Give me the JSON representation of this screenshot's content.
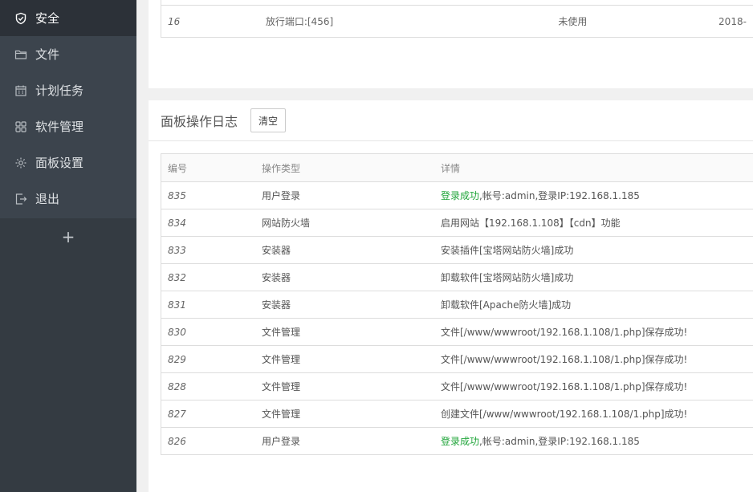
{
  "sidebar": {
    "items": [
      {
        "label": "安全",
        "icon": "shield-icon",
        "active": true
      },
      {
        "label": "文件",
        "icon": "folder-icon",
        "active": false
      },
      {
        "label": "计划任务",
        "icon": "calendar-icon",
        "active": false
      },
      {
        "label": "软件管理",
        "icon": "grid-icon",
        "active": false
      },
      {
        "label": "面板设置",
        "icon": "gear-icon",
        "active": false
      },
      {
        "label": "退出",
        "icon": "logout-icon",
        "active": false
      }
    ],
    "add_label": "+"
  },
  "top_table": {
    "row": {
      "id": "16",
      "name": "放行端口:[456]",
      "status": "未使用",
      "time": "2018-"
    }
  },
  "log": {
    "title": "面板操作日志",
    "clear_label": "清空",
    "columns": [
      "编号",
      "操作类型",
      "详情"
    ],
    "rows": [
      {
        "id": "835",
        "type": "用户登录",
        "detail_prefix": "登录成功",
        "detail": ",帐号:admin,登录IP:192.168.1.185"
      },
      {
        "id": "834",
        "type": "网站防火墙",
        "detail_prefix": "",
        "detail": "启用网站【192.168.1.108】【cdn】功能"
      },
      {
        "id": "833",
        "type": "安装器",
        "detail_prefix": "",
        "detail": "安装插件[宝塔网站防火墙]成功"
      },
      {
        "id": "832",
        "type": "安装器",
        "detail_prefix": "",
        "detail": "卸载软件[宝塔网站防火墙]成功"
      },
      {
        "id": "831",
        "type": "安装器",
        "detail_prefix": "",
        "detail": "卸载软件[Apache防火墙]成功"
      },
      {
        "id": "830",
        "type": "文件管理",
        "detail_prefix": "",
        "detail": "文件[/www/wwwroot/192.168.1.108/1.php]保存成功!"
      },
      {
        "id": "829",
        "type": "文件管理",
        "detail_prefix": "",
        "detail": "文件[/www/wwwroot/192.168.1.108/1.php]保存成功!"
      },
      {
        "id": "828",
        "type": "文件管理",
        "detail_prefix": "",
        "detail": "文件[/www/wwwroot/192.168.1.108/1.php]保存成功!"
      },
      {
        "id": "827",
        "type": "文件管理",
        "detail_prefix": "",
        "detail": "创建文件[/www/wwwroot/192.168.1.108/1.php]成功!"
      },
      {
        "id": "826",
        "type": "用户登录",
        "detail_prefix": "登录成功",
        "detail": ",帐号:admin,登录IP:192.168.1.185"
      }
    ]
  },
  "colors": {
    "sidebar_bg": "#3c444d",
    "sidebar_active": "#2c3138",
    "success_green": "#20a53a"
  }
}
